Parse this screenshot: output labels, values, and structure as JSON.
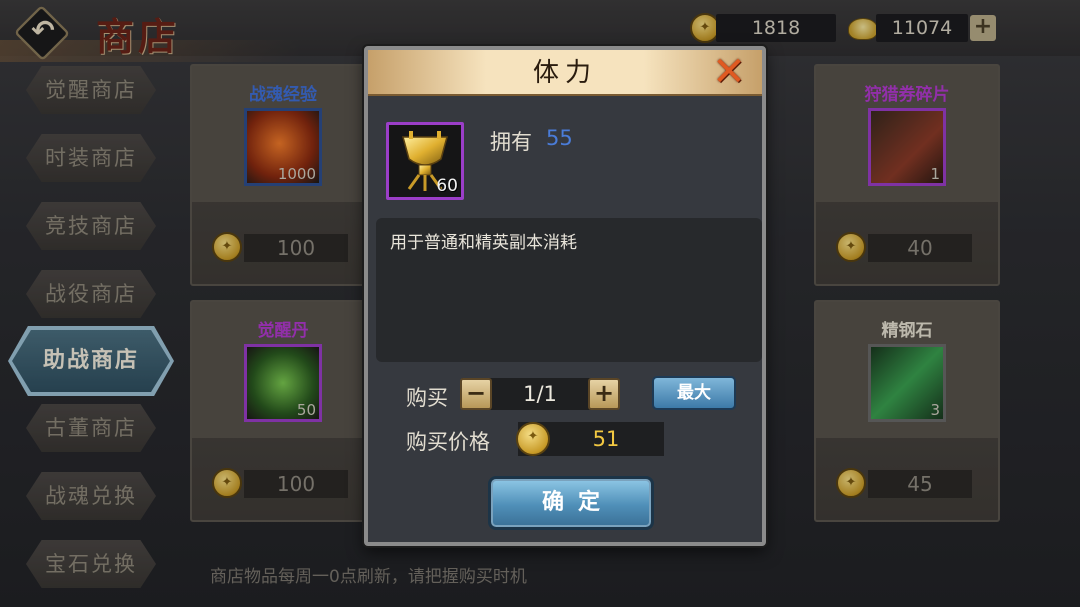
{
  "header": {
    "title": "商店",
    "currency_gold": "1818",
    "currency_ingot": "11074",
    "add_label": "+"
  },
  "sidebar": {
    "items": [
      {
        "label": "觉醒商店"
      },
      {
        "label": "时装商店"
      },
      {
        "label": "竞技商店"
      },
      {
        "label": "战役商店"
      },
      {
        "label": "助战商店",
        "active": true
      },
      {
        "label": "古董商店"
      },
      {
        "label": "战魂兑换"
      },
      {
        "label": "宝石兑换"
      }
    ]
  },
  "cards": [
    {
      "name": "战魂经验",
      "qty": "1000",
      "price": "100",
      "name_color": "#3f6fd8"
    },
    {
      "name": "狩猎券碎片",
      "qty": "1",
      "price": "40",
      "name_color": "#b23ad0"
    },
    {
      "name": "觉醒丹",
      "qty": "50",
      "price": "100",
      "name_color": "#b23ad0"
    },
    {
      "name": "精钢石",
      "qty": "3",
      "price": "45",
      "name_color": "#e6e1d2"
    }
  ],
  "notice": "商店物品每周一0点刷新，请把握购买时机",
  "dialog": {
    "title": "体力",
    "close_icon": "close-x-icon",
    "item_qty": "60",
    "own_label": "拥有",
    "own_value": "55",
    "description": "用于普通和精英副本消耗",
    "buy_label": "购买",
    "minus_label": "−",
    "quantity": "1/1",
    "plus_label": "+",
    "max_label": "最大",
    "price_label": "购买价格",
    "price_value": "51",
    "confirm_label": "确定"
  },
  "colors": {
    "accent_blue": "#4a7cd8",
    "gold": "#f2c842",
    "purple_frame": "#9b3ec8"
  }
}
